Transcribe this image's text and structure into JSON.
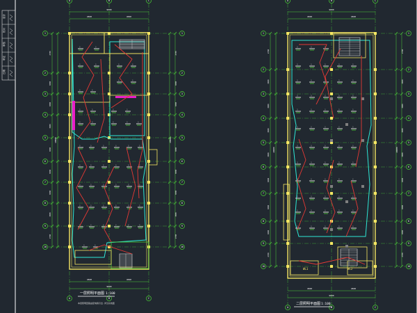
{
  "app": {
    "background": "#212830",
    "colors": {
      "axis": "#4cd137",
      "wall": "#f5e663",
      "dim": "#ffffff",
      "wire": "#e53935",
      "fixture": "#c8c8c8",
      "outline": "#2ee8d6",
      "equipment": "#e91ec8",
      "grey_block": "#7f7f7f"
    }
  },
  "drawing": {
    "left_plan": {
      "name": "floor-plan-left",
      "title": "一层照明平面图",
      "scale": "1:100",
      "note": "本层照明回路由配电箱引出, 详见系统图",
      "dim_top": "9000",
      "dim_top_sub": [
        "4500",
        "4500"
      ],
      "dim_bottom": "9000",
      "dim_bottom_sub": [
        "4500",
        "4500"
      ],
      "dim_left": [
        "2700",
        "3000",
        "3000",
        "3000",
        "3000",
        "3000",
        "3000",
        "3000",
        "2700"
      ],
      "dim_total": "48000",
      "axis_rows": [
        "1",
        "2",
        "3",
        "4",
        "5",
        "6",
        "7",
        "8",
        "9",
        "10"
      ],
      "axis_cols": [
        "A",
        "B",
        "C"
      ]
    },
    "right_plan": {
      "name": "floor-plan-right",
      "title": "二层照明平面图",
      "scale": "1:100",
      "dim_top": "9000",
      "dim_top_sub": [
        "4500",
        "4500"
      ],
      "dim_bottom": "9000",
      "dim_bottom_sub": [
        "4500",
        "4500"
      ],
      "dim_left": [
        "2700",
        "3000",
        "3000",
        "3000",
        "3000",
        "3000",
        "3000",
        "3000",
        "2700"
      ],
      "dim_total": "48000",
      "axis_rows": [
        "1",
        "2",
        "3",
        "4",
        "5",
        "6",
        "7",
        "8",
        "9",
        "10"
      ],
      "axis_cols": [
        "A",
        "B",
        "C"
      ],
      "labels": [
        "WL1",
        "WL2"
      ]
    },
    "title_block": {
      "name": "title-block-strip",
      "rows": [
        "设计",
        "校对",
        "审核",
        "审定",
        "日期"
      ]
    },
    "fixture_label": "3"
  }
}
